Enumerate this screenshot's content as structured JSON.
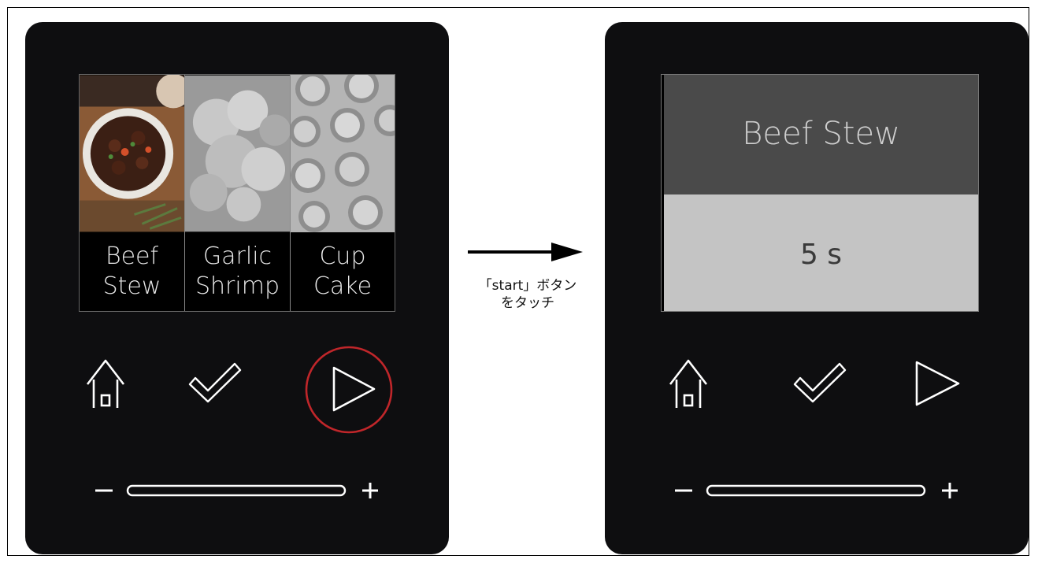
{
  "left_panel": {
    "menu_items": [
      {
        "line1": "Beef",
        "line2": "Stew"
      },
      {
        "line1": "Garlic",
        "line2": "Shrimp"
      },
      {
        "line1": "Cup",
        "line2": "Cake"
      }
    ],
    "highlight_color": "#c0262a"
  },
  "transition": {
    "line1": "「start」ボタン",
    "line2": "をタッチ"
  },
  "right_panel": {
    "recipe_title": "Beef Stew",
    "timer": "5 s"
  },
  "controls": {
    "minus": "−",
    "plus": "+"
  }
}
